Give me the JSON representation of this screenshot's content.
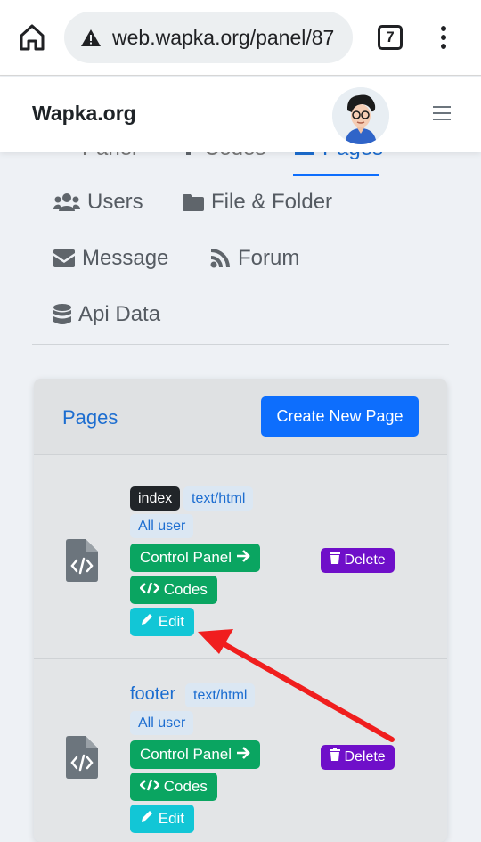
{
  "browser": {
    "url": "web.wapka.org/panel/87",
    "tab_count": "7"
  },
  "site": {
    "brand": "Wapka.org"
  },
  "nav": {
    "top_partial": [
      "Panel",
      "Codes",
      "Pages"
    ],
    "items": [
      {
        "label": "Users",
        "icon": "users-icon"
      },
      {
        "label": "File & Folder",
        "icon": "folder-icon"
      },
      {
        "label": "Message",
        "icon": "envelope-icon"
      },
      {
        "label": "Forum",
        "icon": "rss-icon"
      },
      {
        "label": "Api Data",
        "icon": "database-icon"
      }
    ]
  },
  "pages_card": {
    "title": "Pages",
    "create_button": "Create New Page",
    "rows": [
      {
        "name": "index",
        "type": "text/html",
        "access": "All user",
        "control_panel": "Control Panel",
        "codes": "Codes",
        "edit": "Edit",
        "delete": "Delete"
      },
      {
        "name": "footer",
        "type": "text/html",
        "access": "All user",
        "control_panel": "Control Panel",
        "codes": "Codes",
        "edit": "Edit",
        "delete": "Delete"
      }
    ]
  },
  "colors": {
    "primary": "#0d6efd",
    "success": "#0aa561",
    "info": "#12c6d6",
    "purple": "#6f0fc9",
    "annotation_arrow": "#f01e1e"
  }
}
